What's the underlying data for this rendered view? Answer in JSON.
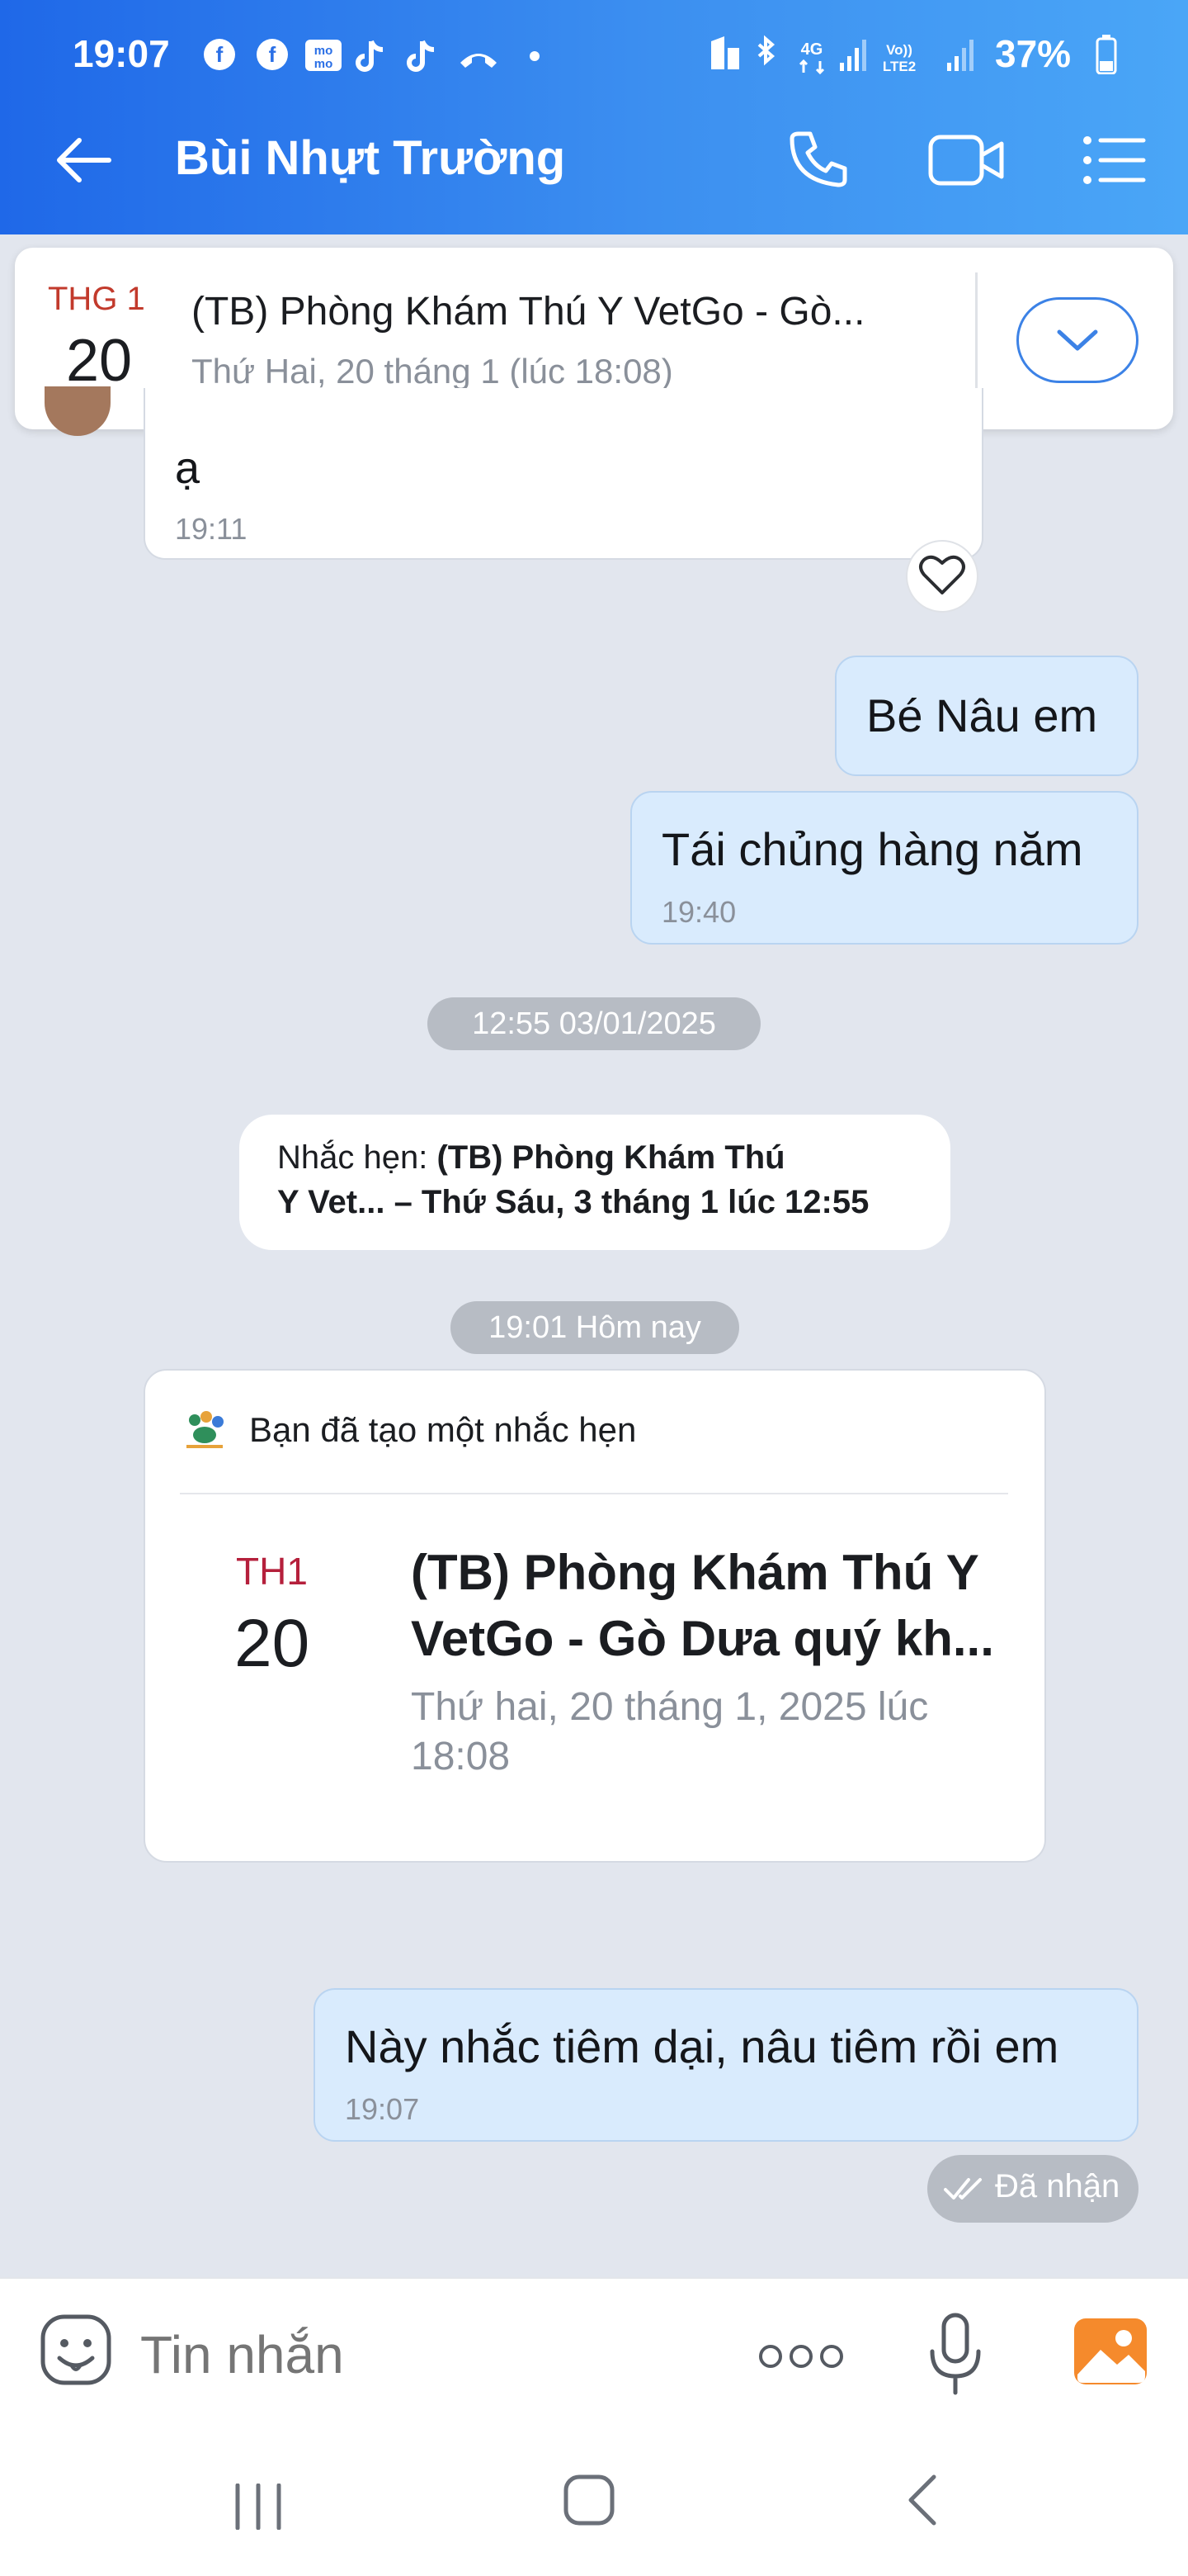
{
  "status_bar": {
    "time": "19:07",
    "network": "4G",
    "network2": "LTE2",
    "battery": "37%"
  },
  "header": {
    "title": "Bùi Nhựt Trường"
  },
  "pinned_reminder": {
    "month": "THG 1",
    "day": "20",
    "title": "(TB) Phòng Khám Thú Y  VetGo - Gò...",
    "datetime": "Thứ Hai, 20 tháng 1 (lúc 18:08)"
  },
  "messages": {
    "incoming_partial": {
      "text": "ạ",
      "time": "19:11"
    },
    "out1": {
      "text": "Bé Nâu em"
    },
    "out2": {
      "text": "Tái chủng hàng năm",
      "time": "19:40"
    },
    "divider1": "12:55 03/01/2025",
    "system_reminder": {
      "label": "Nhắc hẹn:",
      "line1_bold": "(TB) Phòng Khám Thú",
      "line2_bold": "Y  Vet... – Thứ Sáu, 3 tháng 1 lúc 12:55"
    },
    "divider2": "19:01 Hôm nay",
    "reminder_card": {
      "header": "Bạn đã tạo một nhắc hẹn",
      "month": "TH1",
      "day": "20",
      "title_line1": "(TB) Phòng Khám Thú Y",
      "title_line2": "VetGo - Gò Dưa quý kh...",
      "date_line1": "Thứ hai, 20 tháng 1, 2025 lúc",
      "date_line2": "18:08"
    },
    "out3": {
      "text": "Này nhắc tiêm dại, nâu tiêm rồi em",
      "time": "19:07"
    },
    "receipt": "Đã nhận"
  },
  "input": {
    "placeholder": "Tin nhắn"
  },
  "colors": {
    "header_start": "#1f68e8",
    "header_end": "#4aa6f7",
    "outgoing_bubble": "#d9ebfd",
    "reminder_red": "#c0392b",
    "chat_bg": "#e2e6ee"
  }
}
